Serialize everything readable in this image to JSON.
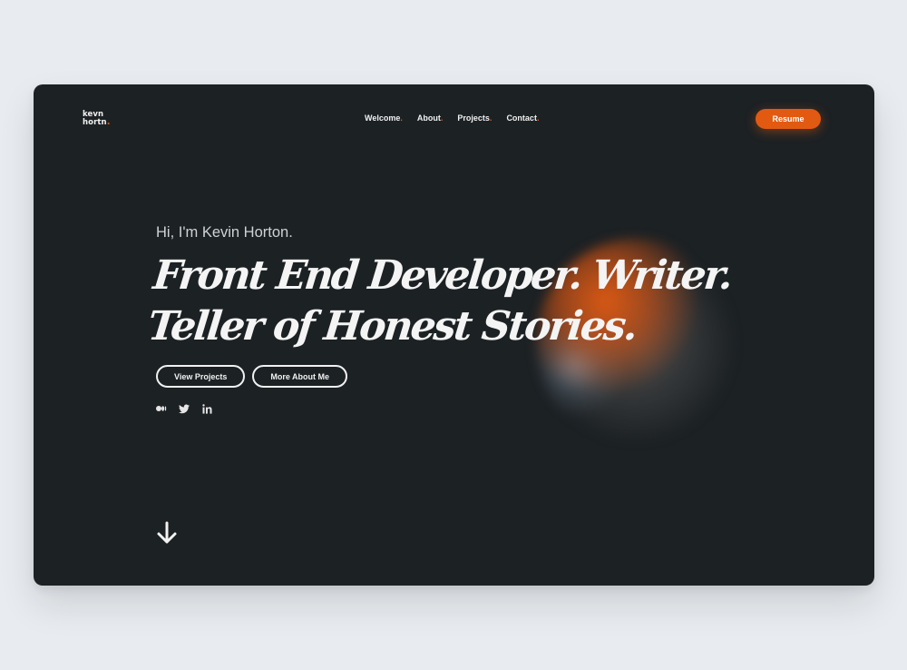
{
  "header": {
    "logo_line1": "kevn",
    "logo_line2": "hortn",
    "logo_dot": ".",
    "nav": [
      {
        "label": "Welcome",
        "dot": "."
      },
      {
        "label": "About",
        "dot": "."
      },
      {
        "label": "Projects",
        "dot": "."
      },
      {
        "label": "Contact",
        "dot": "."
      }
    ],
    "resume_label": "Resume"
  },
  "hero": {
    "greeting": "Hi, I'm Kevin Horton.",
    "headline_line1": "Front End Developer.  Writer.",
    "headline_line2": "Teller of Honest Stories.",
    "primary_cta": "View Projects",
    "secondary_cta": "More About Me"
  },
  "social": [
    {
      "icon": "medium-icon"
    },
    {
      "icon": "twitter-icon"
    },
    {
      "icon": "linkedin-icon"
    }
  ],
  "colors": {
    "page_background": "#e8ecf0",
    "panel_background": "#1c2124",
    "accent": "#e25a12",
    "text": "#f4f4f4"
  }
}
